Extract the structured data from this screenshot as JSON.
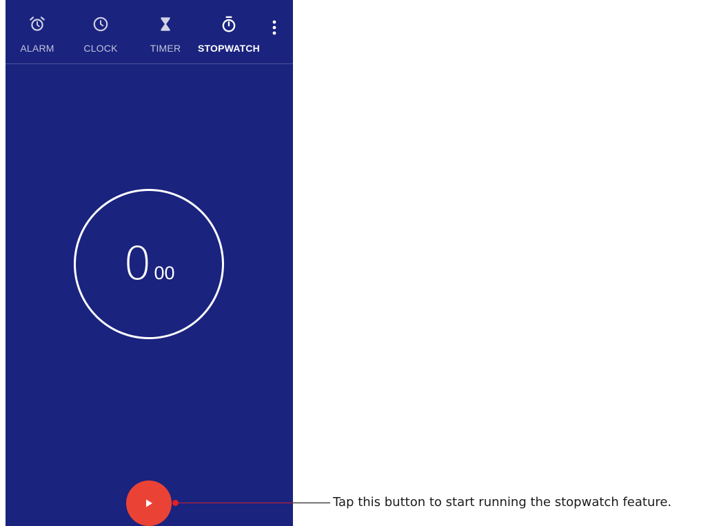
{
  "tabs": [
    {
      "label": "ALARM",
      "icon": "alarm-icon"
    },
    {
      "label": "CLOCK",
      "icon": "clock-icon"
    },
    {
      "label": "TIMER",
      "icon": "hourglass-icon"
    },
    {
      "label": "STOPWATCH",
      "icon": "stopwatch-icon",
      "active": true
    }
  ],
  "menu": {
    "icon": "more-vert-icon"
  },
  "stopwatch": {
    "seconds": "0",
    "hundredths": "00"
  },
  "start_button": {
    "icon": "play-icon"
  },
  "annotation": {
    "text": "Tap this button to start running the stopwatch feature."
  },
  "colors": {
    "background": "#1a237e",
    "fab": "#ea4335",
    "callout": "#d21f2b"
  }
}
